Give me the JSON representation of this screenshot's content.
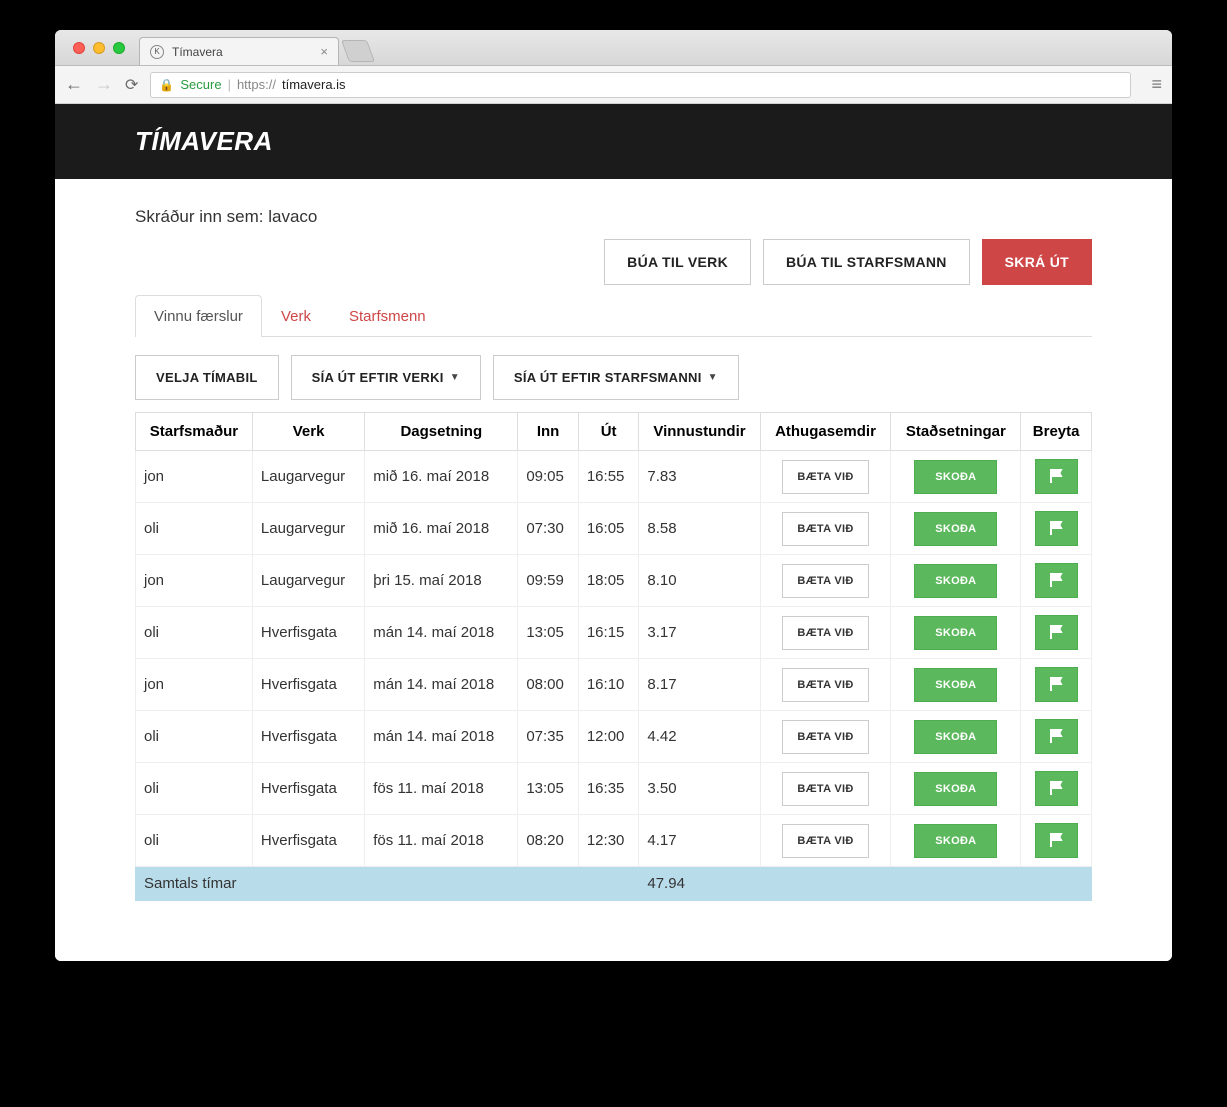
{
  "browser": {
    "tab_title": "Tímavera",
    "secure_label": "Secure",
    "url_proto": "https://",
    "url_host": "tímavera.is"
  },
  "header": {
    "brand": "TÍMAVERA"
  },
  "logged_in_prefix": "Skráður inn sem: ",
  "logged_in_user": "lavaco",
  "actions": {
    "create_project": "BÚA TIL VERK",
    "create_employee": "BÚA TIL STARFSMANN",
    "logout": "SKRÁ ÚT"
  },
  "tabs": {
    "entries": "Vinnu færslur",
    "projects": "Verk",
    "employees": "Starfsmenn"
  },
  "filters": {
    "period": "VELJA TÍMABIL",
    "by_project": "SÍA ÚT EFTIR VERKI",
    "by_employee": "SÍA ÚT EFTIR STARFSMANNI"
  },
  "table": {
    "headers": {
      "employee": "Starfsmaður",
      "project": "Verk",
      "date": "Dagsetning",
      "in": "Inn",
      "out": "Út",
      "hours": "Vinnustundir",
      "notes": "Athugasemdir",
      "locations": "Staðsetningar",
      "edit": "Breyta"
    },
    "row_buttons": {
      "add_note": "BÆTA VIÐ",
      "view": "SKOÐA"
    },
    "rows": [
      {
        "employee": "jon",
        "project": "Laugarvegur",
        "date": "mið 16. maí 2018",
        "in": "09:05",
        "out": "16:55",
        "hours": "7.83"
      },
      {
        "employee": "oli",
        "project": "Laugarvegur",
        "date": "mið 16. maí 2018",
        "in": "07:30",
        "out": "16:05",
        "hours": "8.58"
      },
      {
        "employee": "jon",
        "project": "Laugarvegur",
        "date": "þri 15. maí 2018",
        "in": "09:59",
        "out": "18:05",
        "hours": "8.10"
      },
      {
        "employee": "oli",
        "project": "Hverfisgata",
        "date": "mán 14. maí 2018",
        "in": "13:05",
        "out": "16:15",
        "hours": "3.17"
      },
      {
        "employee": "jon",
        "project": "Hverfisgata",
        "date": "mán 14. maí 2018",
        "in": "08:00",
        "out": "16:10",
        "hours": "8.17"
      },
      {
        "employee": "oli",
        "project": "Hverfisgata",
        "date": "mán 14. maí 2018",
        "in": "07:35",
        "out": "12:00",
        "hours": "4.42"
      },
      {
        "employee": "oli",
        "project": "Hverfisgata",
        "date": "fös 11. maí 2018",
        "in": "13:05",
        "out": "16:35",
        "hours": "3.50"
      },
      {
        "employee": "oli",
        "project": "Hverfisgata",
        "date": "fös 11. maí 2018",
        "in": "08:20",
        "out": "12:30",
        "hours": "4.17"
      }
    ],
    "footer": {
      "label": "Samtals tímar",
      "total": "47.94"
    }
  }
}
